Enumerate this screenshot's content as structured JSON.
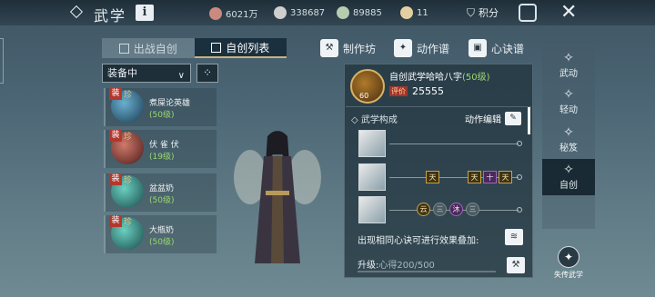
{
  "topbar": {
    "title": "武学",
    "info_label": "i",
    "resources": [
      {
        "icon": "coin-pouch-icon",
        "value": "6021万",
        "color": "#e0b0a8"
      },
      {
        "icon": "ingot-icon",
        "value": "338687",
        "color": "#d8d8d8"
      },
      {
        "icon": "jade-icon",
        "value": "89885",
        "color": "#c8d8c0"
      },
      {
        "icon": "scroll-icon",
        "value": "11",
        "color": "#e8d8b0"
      }
    ],
    "score_label": "积分"
  },
  "left": {
    "tabs": [
      {
        "label": "出战自创",
        "active": false
      },
      {
        "label": "自创列表",
        "active": true
      }
    ],
    "filter": "装备中",
    "skills": [
      {
        "badge": "装",
        "sub": "珍",
        "name": "煮屎论英雄",
        "level": "(50级)",
        "color": "#2a6a8a"
      },
      {
        "badge": "装",
        "sub": "珍",
        "name": "伏 雀 伏",
        "level": "(19级)",
        "color": "#7a2a2a"
      },
      {
        "badge": "装",
        "sub": "珍",
        "name": "盆盆奶",
        "level": "(50级)",
        "color": "#2a7a7a"
      },
      {
        "badge": "装",
        "sub": "珍",
        "name": "大瓶奶",
        "level": "(50级)",
        "color": "#2a7a7a"
      }
    ]
  },
  "actions": {
    "workshop": "制作坊",
    "moves": "动作谱",
    "mind": "心诀谱"
  },
  "detail": {
    "emblem_level": "60",
    "name": "自创武学哈哈八字",
    "level": "(50级)",
    "rating_label": "评价",
    "rating": "25555",
    "section_title": "武学构成",
    "edit_label": "动作编辑",
    "rows": [
      {
        "nodes": []
      },
      {
        "nodes": [
          {
            "t": "天",
            "kind": "gold",
            "pos": 0.38
          },
          {
            "t": "天",
            "kind": "gold",
            "pos": 0.6
          },
          {
            "t": "十",
            "kind": "purple",
            "pos": 0.72
          },
          {
            "t": "天",
            "kind": "gold",
            "pos": 0.84
          }
        ]
      },
      {
        "nodes": [
          {
            "t": "云",
            "kind": "gold",
            "pos": 0.28
          },
          {
            "t": "三",
            "kind": "round",
            "pos": 0.41
          },
          {
            "t": "沐",
            "kind": "purple",
            "pos": 0.54
          },
          {
            "t": "三",
            "kind": "round",
            "pos": 0.67
          }
        ]
      }
    ],
    "stack_text": "出现相同心诀可进行效果叠加:",
    "upgrade_label": "升级:",
    "upgrade_progress": "心得200/500"
  },
  "sidenav": [
    {
      "label": "武动",
      "active": false
    },
    {
      "label": "轻动",
      "active": false
    },
    {
      "label": "秘笈",
      "active": false
    },
    {
      "label": "自创",
      "active": true
    }
  ],
  "lost_label": "失传武学"
}
